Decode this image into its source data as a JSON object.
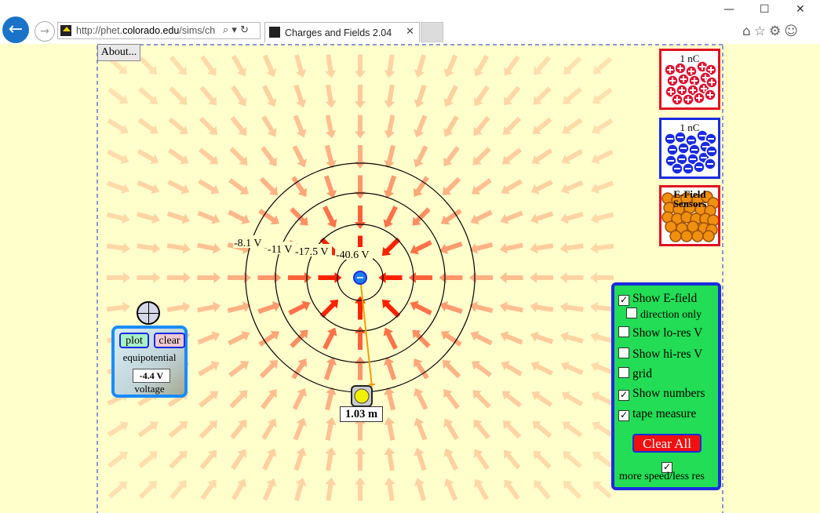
{
  "browser": {
    "url_prefix": "http://phet.",
    "url_domain": "colorado.edu",
    "url_suffix": "/sims/ch",
    "tab_title": "Charges and Fields 2.04",
    "window_minimize": "—",
    "window_maximize": "☐",
    "window_close": "✕",
    "addr_icons": "⌕ ▾ ↻",
    "tab_close": "✕",
    "toolbar_icons": "⌂☆⚙☺"
  },
  "sim": {
    "about_label": "About...",
    "positive_bucket_label": "1 nC",
    "negative_bucket_label": "1 nC",
    "sensors_bucket_label_line1": "E-Field",
    "sensors_bucket_label_line2": "Sensors",
    "equipotential_labels": [
      "-8.1 V",
      "-11 V",
      "-17.5 V",
      "-40.6 V"
    ],
    "tape_measure_reading": "1.03 m",
    "voltmeter": {
      "plot_label": "plot",
      "clear_label": "clear",
      "equipotential_label": "equipotential",
      "reading": "-4.4 V",
      "voltage_label": "voltage"
    },
    "controls": {
      "show_efield": {
        "label": "Show E-field",
        "checked": true
      },
      "direction_only": {
        "label": "direction only",
        "checked": false
      },
      "show_lores_v": {
        "label": "Show lo-res V",
        "checked": false
      },
      "show_hires_v": {
        "label": "Show hi-res V",
        "checked": false
      },
      "grid": {
        "label": "grid",
        "checked": false
      },
      "show_numbers": {
        "label": "Show numbers",
        "checked": true
      },
      "tape_measure": {
        "label": "tape measure",
        "checked": true
      },
      "clear_all_label": "Clear All",
      "more_speed": {
        "label": "more speed/less res",
        "checked": true
      }
    },
    "colors": {
      "background": "#ffffcc",
      "arrow": "#ff2200",
      "positive": "#e01030",
      "negative": "#1a2be0",
      "sensor": "#f09010",
      "panel": "#22dd55"
    }
  }
}
